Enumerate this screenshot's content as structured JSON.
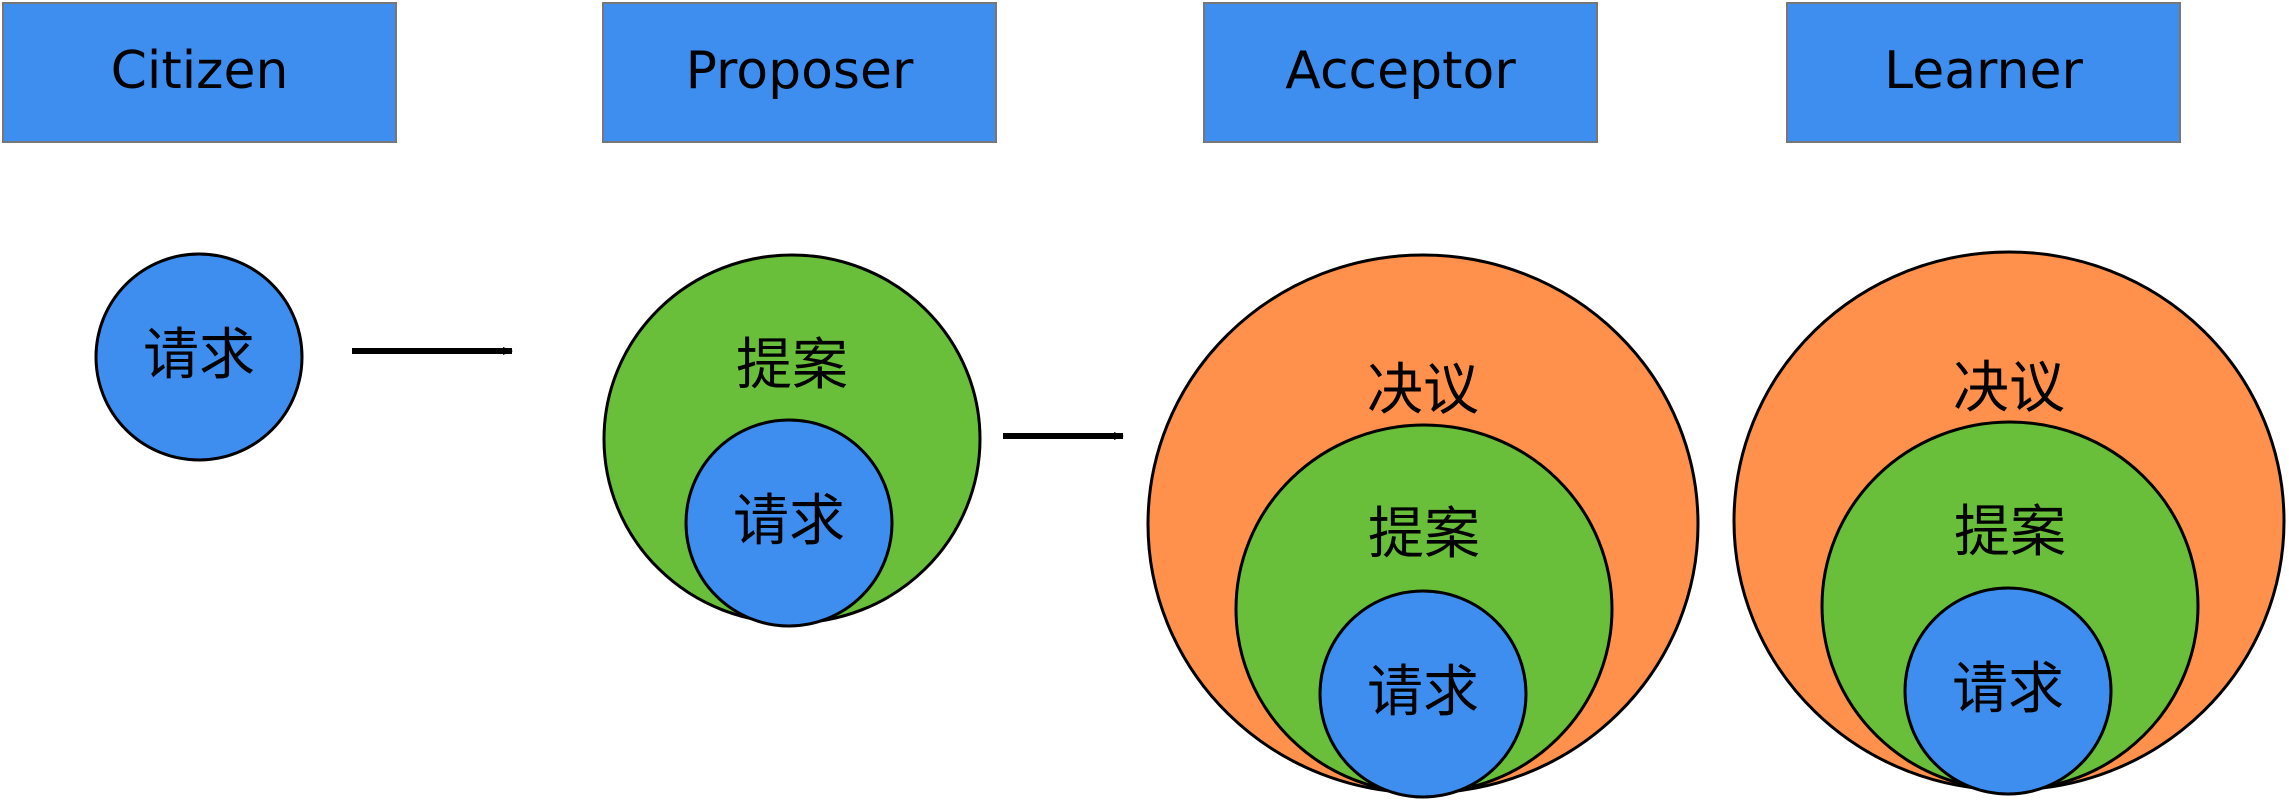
{
  "roles": [
    "Citizen",
    "Proposer",
    "Acceptor",
    "Learner"
  ],
  "terms": {
    "request": "请求",
    "proposal": "提案",
    "resolution": "决议"
  },
  "colors": {
    "blue": "#3D8EEF",
    "green": "#69BE3A",
    "orange": "#FF914D",
    "stroke": "#000000",
    "header_border": "#777777"
  }
}
